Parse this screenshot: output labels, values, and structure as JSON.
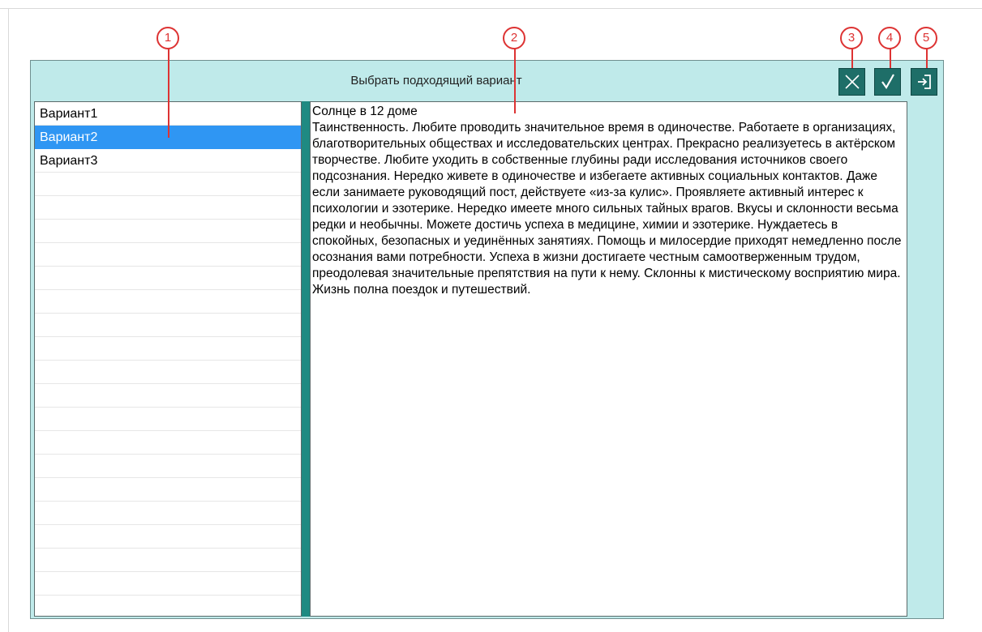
{
  "window": {
    "title": "Выбрать подходящий вариант"
  },
  "toolbar": {
    "cancel": "cancel-icon",
    "confirm": "check-icon",
    "exit": "exit-icon"
  },
  "list": {
    "items": [
      "Вариант1",
      "Вариант2",
      "Вариант3"
    ],
    "selected_index": 1
  },
  "content": {
    "title": "Солнце в 12 доме",
    "body": "Таинственность. Любите проводить значительное время в одиночестве. Работаете в организациях, благотворительных обществах и исследовательских центрах. Прекрасно реализуетесь в актёрском творчестве. Любите уходить в собственные глубины ради исследования источников своего подсознания. Нередко живете в одиночестве и избегаете активных социальных контактов. Даже если занимаете руководящий пост, действуете «из-за кулис». Проявляете активный интерес к психологии и эзотерике. Нередко имеете много сильных тайных врагов. Вкусы и склонности весьма редки и необычны. Можете достичь успеха в медицине, химии и эзотерике. Нуждаетесь в спокойных, безопасных и уединённых занятиях. Помощь и милосердие приходят немедленно после осознания вами потребности. Успеха в жизни достигаете честным самоотверженным трудом, преодолевая значительные препятствия на пути к нему. Склонны к мистическому восприятию мира. Жизнь полна поездок и путешествий."
  },
  "callouts": [
    "1",
    "2",
    "3",
    "4",
    "5"
  ],
  "colors": {
    "window_bg": "#bfeaea",
    "button_bg": "#1e6e68",
    "selection": "#2f96f3",
    "splitter": "#1f8a82",
    "callout": "#dd3333"
  }
}
